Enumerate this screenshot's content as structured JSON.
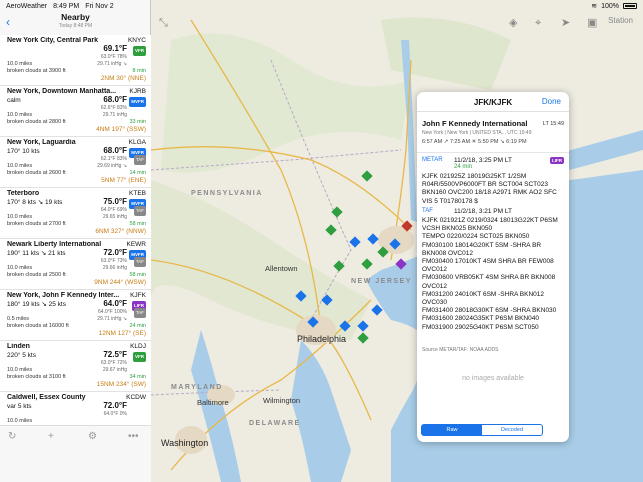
{
  "status": {
    "app": "AeroWeather",
    "time": "8:49 PM",
    "date": "Fri Nov 2",
    "battery": "100%"
  },
  "sidebar": {
    "title": "Nearby",
    "subtitle": "Today 8:48 PM",
    "stations": [
      {
        "name": "New York City, Central Park",
        "id": "KNYC",
        "wind": "",
        "temp": "69.1°F",
        "cat": "VFR",
        "cat_color": "#2e9e3e",
        "dew": "63.0°F 78%",
        "vis": "10.0 miles",
        "alt": "29.71 inHg ↘",
        "sky": "broken clouds at 3900 ft",
        "age": "8 min",
        "dist": "2NM 30° (NNE)",
        "taf": false
      },
      {
        "name": "New York, Downtown Manhatta...",
        "id": "KJRB",
        "wind": "calm",
        "temp": "68.0°F",
        "cat": "MVFR",
        "cat_color": "#1a73e8",
        "dew": "62.6°F 83%",
        "vis": "10.0 miles",
        "alt": "29.71 inHg",
        "sky": "broken clouds at 2800 ft",
        "age": "33 min",
        "dist": "4NM 197° (SSW)",
        "taf": false
      },
      {
        "name": "New York, Laguardia",
        "id": "KLGA",
        "wind": "170° 10 kts",
        "temp": "68.0°F",
        "cat": "MVFR",
        "cat_color": "#1a73e8",
        "dew": "62.1°F 83%",
        "vis": "10.0 miles",
        "alt": "29.69 inHg ↘",
        "sky": "broken clouds at 2600 ft",
        "age": "14 min",
        "dist": "5NM 77° (ENE)",
        "taf": true
      },
      {
        "name": "Teterboro",
        "id": "KTEB",
        "wind": "170° 8 kts ↘ 19 kts",
        "temp": "75.0°F",
        "cat": "MVFR",
        "cat_color": "#1a73e8",
        "dew": "64.0°F 69%",
        "vis": "10.0 miles",
        "alt": "29.65 inHg",
        "sky": "broken clouds at 2700 ft",
        "age": "58 min",
        "dist": "6NM 327° (NNW)",
        "taf": true
      },
      {
        "name": "Newark Liberty International",
        "id": "KEWR",
        "wind": "190° 11 kts ↘ 21 kts",
        "temp": "72.0°F",
        "cat": "MVFR",
        "cat_color": "#1a73e8",
        "dew": "63.0°F 73%",
        "vis": "10.0 miles",
        "alt": "29.66 inHg",
        "sky": "broken clouds at 2500 ft",
        "age": "58 min",
        "dist": "9NM 244° (WSW)",
        "taf": true
      },
      {
        "name": "New York, John F Kennedy Inter...",
        "id": "KJFK",
        "wind": "180° 19 kts ↘ 25 kts",
        "temp": "64.0°F",
        "cat": "LIFR",
        "cat_color": "#8a35c5",
        "dew": "64.0°F 100%",
        "vis": "0.5 miles",
        "alt": "29.71 inHg ↘",
        "sky": "broken clouds at 16000 ft",
        "age": "24 min",
        "dist": "12NM 127° (SE)",
        "taf": true,
        "extra": "mist"
      },
      {
        "name": "Linden",
        "id": "KLDJ",
        "wind": "220° 5 kts",
        "temp": "72.5°F",
        "cat": "VFR",
        "cat_color": "#2e9e3e",
        "dew": "63.0°F 72%",
        "vis": "10.0 miles",
        "alt": "29.67 inHg",
        "sky": "broken clouds at 3100 ft",
        "age": "34 min",
        "dist": "15NM 234° (SW)",
        "taf": false
      },
      {
        "name": "Caldwell, Essex County",
        "id": "KCDW",
        "wind": "var 5 kts",
        "temp": "72.0°F",
        "cat": "",
        "cat_color": "#2e9e3e",
        "dew": "64.0°F 0%",
        "vis": "10.0 miles",
        "alt": "",
        "sky": "",
        "age": "",
        "dist": "",
        "taf": false
      }
    ]
  },
  "map": {
    "labels": [
      "PENNSYLVANIA",
      "NEW JERSEY",
      "MARYLAND",
      "DELAWARE",
      "Philadelphia",
      "Allentown",
      "Washington",
      "Baltimore",
      "Wilmington"
    ],
    "station_button": "Station"
  },
  "popup": {
    "title": "JFK/KJFK",
    "done": "Done",
    "station_name": "John F Kennedy International",
    "lt": "LT 15:49",
    "location": "New York | New York | UNITED STA...  UTC 19:49",
    "sun": "6:57 AM ↗ 7:25 AM ☀ 5:50 PM ↘ 6:19 PM",
    "metar_tag": "METAR",
    "metar_time": "11/2/18, 3:25 PM LT",
    "metar_age": "24 min",
    "metar_cat": "LIFR",
    "metar_text": "KJFK 021925Z 18019G25KT 1/2SM R04R/5500VP6000FT BR SCT004 SCT023 BKN160 OVC200 18/18 A2971 RMK AO2 SFC VIS 5 T01780178 $",
    "taf_tag": "TAF",
    "taf_time": "11/2/18, 3:21 PM LT",
    "taf_text": "KJFK 021921Z 0219/0324 18013G22KT P6SM VCSH BKN025 BKN050\nTEMPO 0220/0224 SCT025 BKN050\nFM030100 18014G20KT 5SM -SHRA BR BKN008 OVC012\nFM030400 17010KT 4SM SHRA BR FEW008 OVC012\nFM030600 VRB05KT 4SM SHRA BR BKN008 OVC012\nFM031200 24010KT 6SM -SHRA BKN012 OVC030\nFM031400 28018G30KT 6SM -SHRA BKN030\nFM031600 28024G35KT P6SM BKN040\nFM031900 29025G40KT P6SM SCT050",
    "source": "Source METAR/TAF: NOAA ADDS",
    "no_images": "no images available",
    "seg_raw": "Raw",
    "seg_decoded": "Decoded"
  },
  "colors": {
    "accent": "#1a73e8",
    "vfr": "#2e9e3e",
    "mvfr": "#1a73e8",
    "lifr": "#8a35c5",
    "dist": "#c77d12"
  }
}
